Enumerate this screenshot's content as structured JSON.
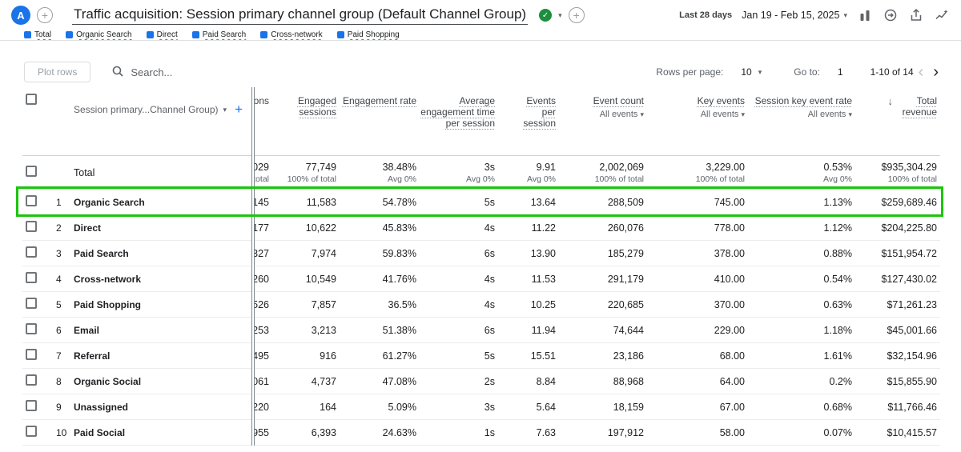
{
  "colors": {
    "annotation_green": "#1cc40e",
    "avatar_blue": "#1a73e8",
    "badge_green": "#1e8e3e",
    "accent_blue": "#1a73e8",
    "series_blue": "#1a73e8"
  },
  "topbar": {
    "avatar_letter": "A",
    "title": "Traffic acquisition: Session primary channel group (Default Channel Group)",
    "date_label": "Last 28 days",
    "date_range": "Jan 19 - Feb 15, 2025"
  },
  "legend": {
    "items": [
      {
        "label": "Total",
        "color": "#1a73e8"
      },
      {
        "label": "Organic Search",
        "color": "#1a73e8"
      },
      {
        "label": "Direct",
        "color": "#1a73e8"
      },
      {
        "label": "Paid Search",
        "color": "#1a73e8"
      },
      {
        "label": "Cross-network",
        "color": "#1a73e8"
      },
      {
        "label": "Paid Shopping",
        "color": "#1a73e8"
      }
    ]
  },
  "toolbar": {
    "plot_rows_label": "Plot rows",
    "search_placeholder": "Search...",
    "rows_per_page_label": "Rows per page:",
    "rows_per_page_value": "10",
    "goto_label": "Go to:",
    "goto_value": "1",
    "range": "1-10 of 14"
  },
  "table": {
    "dimension_header": "Session primary...Channel Group)",
    "add_symbol": "+",
    "sessions_header_fragment": "ions",
    "metric_columns": [
      {
        "label": "Engaged sessions"
      },
      {
        "label": "Engagement rate"
      },
      {
        "label": "Average engagement time per session"
      },
      {
        "label": "Events per session"
      },
      {
        "label": "Event count",
        "filter": "All events"
      },
      {
        "label": "Key events",
        "filter": "All events"
      },
      {
        "label": "Session key event rate",
        "filter": "All events"
      },
      {
        "label": "Total revenue",
        "sorted": true
      }
    ],
    "totals": {
      "label": "Total",
      "sessions_frag": "029",
      "sessions_sub": "of total",
      "engaged": "77,749",
      "engaged_sub": "100% of total",
      "rate": "38.48%",
      "rate_sub": "Avg 0%",
      "avg_time": "3s",
      "avg_time_sub": "Avg 0%",
      "eps": "9.91",
      "eps_sub": "Avg 0%",
      "event_count": "2,002,069",
      "event_count_sub": "100% of total",
      "key_events": "3,229.00",
      "key_events_sub": "100% of total",
      "key_rate": "0.53%",
      "key_rate_sub": "Avg 0%",
      "revenue": "$935,304.29",
      "revenue_sub": "100% of total"
    },
    "rows": [
      {
        "num": "1",
        "name": "Organic Search",
        "sessions_frag": "145",
        "engaged": "11,583",
        "rate": "54.78%",
        "avg_time": "5s",
        "eps": "13.64",
        "event_count": "288,509",
        "key_events": "745.00",
        "key_rate": "1.13%",
        "revenue": "$259,689.46",
        "highlighted": true
      },
      {
        "num": "2",
        "name": "Direct",
        "sessions_frag": "177",
        "engaged": "10,622",
        "rate": "45.83%",
        "avg_time": "4s",
        "eps": "11.22",
        "event_count": "260,076",
        "key_events": "778.00",
        "key_rate": "1.12%",
        "revenue": "$204,225.80"
      },
      {
        "num": "3",
        "name": "Paid Search",
        "sessions_frag": "327",
        "engaged": "7,974",
        "rate": "59.83%",
        "avg_time": "6s",
        "eps": "13.90",
        "event_count": "185,279",
        "key_events": "378.00",
        "key_rate": "0.88%",
        "revenue": "$151,954.72"
      },
      {
        "num": "4",
        "name": "Cross-network",
        "sessions_frag": "260",
        "engaged": "10,549",
        "rate": "41.76%",
        "avg_time": "4s",
        "eps": "11.53",
        "event_count": "291,179",
        "key_events": "410.00",
        "key_rate": "0.54%",
        "revenue": "$127,430.02"
      },
      {
        "num": "5",
        "name": "Paid Shopping",
        "sessions_frag": "526",
        "engaged": "7,857",
        "rate": "36.5%",
        "avg_time": "4s",
        "eps": "10.25",
        "event_count": "220,685",
        "key_events": "370.00",
        "key_rate": "0.63%",
        "revenue": "$71,261.23"
      },
      {
        "num": "6",
        "name": "Email",
        "sessions_frag": "253",
        "engaged": "3,213",
        "rate": "51.38%",
        "avg_time": "6s",
        "eps": "11.94",
        "event_count": "74,644",
        "key_events": "229.00",
        "key_rate": "1.18%",
        "revenue": "$45,001.66"
      },
      {
        "num": "7",
        "name": "Referral",
        "sessions_frag": "495",
        "engaged": "916",
        "rate": "61.27%",
        "avg_time": "5s",
        "eps": "15.51",
        "event_count": "23,186",
        "key_events": "68.00",
        "key_rate": "1.61%",
        "revenue": "$32,154.96"
      },
      {
        "num": "8",
        "name": "Organic Social",
        "sessions_frag": "061",
        "engaged": "4,737",
        "rate": "47.08%",
        "avg_time": "2s",
        "eps": "8.84",
        "event_count": "88,968",
        "key_events": "64.00",
        "key_rate": "0.2%",
        "revenue": "$15,855.90"
      },
      {
        "num": "9",
        "name": "Unassigned",
        "sessions_frag": "220",
        "engaged": "164",
        "rate": "5.09%",
        "avg_time": "3s",
        "eps": "5.64",
        "event_count": "18,159",
        "key_events": "67.00",
        "key_rate": "0.68%",
        "revenue": "$11,766.46"
      },
      {
        "num": "10",
        "name": "Paid Social",
        "sessions_frag": "955",
        "engaged": "6,393",
        "rate": "24.63%",
        "avg_time": "1s",
        "eps": "7.63",
        "event_count": "197,912",
        "key_events": "58.00",
        "key_rate": "0.07%",
        "revenue": "$10,415.57"
      }
    ]
  }
}
